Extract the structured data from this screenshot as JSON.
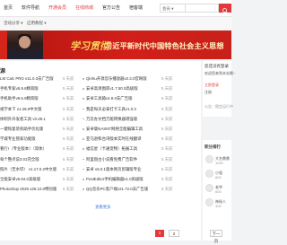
{
  "topnav": {
    "items": [
      {
        "label": "首页",
        "red": false
      },
      {
        "label": "软件导航",
        "red": false
      },
      {
        "label": "开通会员",
        "red": true
      },
      {
        "label": "在线商城",
        "red": true
      },
      {
        "label": "官方公告",
        "red": false
      },
      {
        "label": "宿客端",
        "red": false
      }
    ],
    "search_select": "会员 ▾"
  },
  "subnav": {
    "items": [
      "活动分享 ▾",
      "应用教程 ▾"
    ]
  },
  "banner": {
    "script_text": "学习贯彻",
    "slogan": "习近平新时代中国特色社会主义思想"
  },
  "section": {
    "title": "源"
  },
  "list_left": [
    {
      "text": "LM Calc PRO v11.0.3去广告版",
      "meta": "5 天前"
    },
    {
      "text": "手机专家v5.9.6精简版",
      "meta": "5 天前"
    },
    {
      "text": "手机助手v9.6.9精简版",
      "meta": "5 天前"
    },
    {
      "text": "视学本下 v1.28.0中文版",
      "meta": "5 天前"
    },
    {
      "text": "体制外开发者工具 v3.28.1",
      "meta": "5 天前"
    },
    {
      "text": "一键恢复装机助手优化版",
      "meta": "5 天前"
    },
    {
      "text": "学城专业管家功能版",
      "meta": "5 天前"
    },
    {
      "text": "看行r（专业版本）（简体）",
      "meta": "5 天前"
    },
    {
      "text": "每个整点说3.01完全版",
      "meta": "5 天前"
    },
    {
      "text": "照片（无水印） v1.17.0.2中文版",
      "meta": "5 天前"
    },
    {
      "text": "全能安卓v6.94.0高级版",
      "meta": "5 天前"
    },
    {
      "text": "Photoshop 2025 v26.10.0特别版",
      "meta": "5 天前"
    }
  ],
  "list_right": [
    {
      "text": "Qinhu开源音乐播放器v2.3.0官网版",
      "meta": "5 天前"
    },
    {
      "text": "安卓高清图库v1.7.50.0高级版",
      "meta": "5 天前"
    },
    {
      "text": "安卓工具箱v4.9.0去广告版",
      "meta": "5 天前"
    },
    {
      "text": "我是每天必拿打卡工具v1.0.3",
      "meta": "5 天前"
    },
    {
      "text": "万云办文档万能转换器增强版",
      "meta": "5 天前"
    },
    {
      "text": "安卓版NASNT网络全能编辑工具",
      "meta": "5 天前"
    },
    {
      "text": "亚马逊和台湾版本实时在线翻译",
      "meta": "5 天前"
    },
    {
      "text": "福信星（卡通宠物）拓展工具",
      "meta": "5 天前"
    },
    {
      "text": "阿里盘古小说看免费广告软件",
      "meta": "5 天前"
    },
    {
      "text": "安卓 v5.0.1版本网页剪辑版专业",
      "meta": "5 天前"
    },
    {
      "text": "PostEditor手机编辑器v1.0高级版",
      "meta": "5 天前"
    },
    {
      "text": "QQ音乐PC客户端v21.72.0去广告版",
      "meta": "5 天前"
    }
  ],
  "more_label": "查看更多",
  "sidebar": {
    "user_card": {
      "line1": "您还没有登录",
      "line2": "欢迎您来到本站哦~",
      "login_label": "立即登录",
      "register_label": "注册"
    },
    "notice_label": "公告：稳定运行中",
    "rank_title": "积分排行",
    "rank_items": [
      {
        "name": "大名鼎鼎",
        "score": "1000"
      },
      {
        "name": "小强",
        "score": "800"
      },
      {
        "name": "老爷",
        "score": "600"
      },
      {
        "name": "神秘人",
        "score": "400"
      }
    ]
  },
  "pager": {
    "prev": "1",
    "next": "2",
    "p3": "下一页"
  },
  "colors": {
    "accent": "#e4393c",
    "banner_red": "#c8201a",
    "link_blue": "#3b7de0"
  }
}
